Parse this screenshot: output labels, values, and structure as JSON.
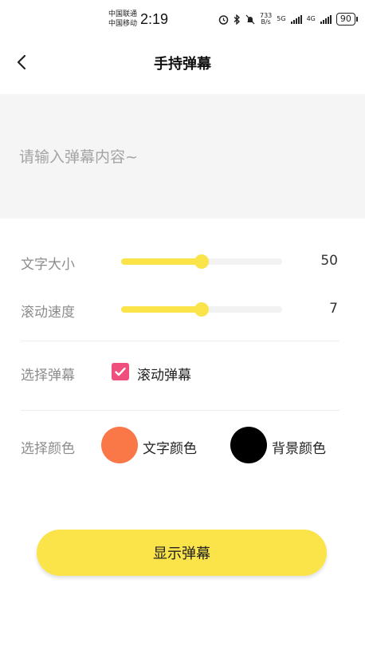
{
  "status_bar": {
    "carrier1": "中国联通",
    "carrier2": "中国移动",
    "time": "2:19",
    "net_speed_top": "733",
    "net_speed_bottom": "B/s",
    "net1": "5G",
    "net2": "4G",
    "battery": "90"
  },
  "header": {
    "title": "手持弹幕"
  },
  "input": {
    "placeholder": "请输入弹幕内容~",
    "value": ""
  },
  "settings": {
    "font_size": {
      "label": "文字大小",
      "value": "50",
      "fraction": 0.5
    },
    "scroll_speed": {
      "label": "滚动速度",
      "value": "7",
      "fraction": 0.5
    }
  },
  "danmaku": {
    "label": "选择弹幕",
    "option": "滚动弹幕",
    "checked": true
  },
  "colors": {
    "label": "选择颜色",
    "text_color_label": "文字颜色",
    "text_color": "#fa7748",
    "bg_color_label": "背景颜色",
    "bg_color": "#000000"
  },
  "theme": {
    "accent": "#fbe44a",
    "checkbox": "#ef4f7c"
  },
  "actions": {
    "show_label": "显示弹幕"
  }
}
